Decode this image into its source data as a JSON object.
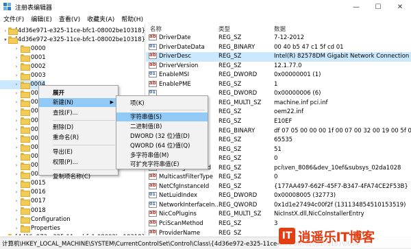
{
  "window": {
    "title": "注册表编辑器",
    "minimize": "—",
    "maximize": "☐",
    "close": "✕"
  },
  "menu": [
    "文件(F)",
    "编辑(E)",
    "查看(V)",
    "收藏夹(A)",
    "帮助(H)"
  ],
  "tree": {
    "items": [
      {
        "label": "{4d36e971-e325-11ce-bfc1-08002be10318}",
        "indent": 0,
        "expanded": false
      },
      {
        "label": "{4d36e972-e325-11ce-bfc1-08002be10318}",
        "indent": 0,
        "expanded": true
      },
      {
        "label": "0000",
        "indent": 1
      },
      {
        "label": "0001",
        "indent": 1
      },
      {
        "label": "0002",
        "indent": 1
      },
      {
        "label": "0003",
        "indent": 1
      },
      {
        "label": "0004",
        "indent": 1,
        "selected": true
      },
      {
        "label": "0005",
        "indent": 1
      },
      {
        "label": "0006",
        "indent": 1
      },
      {
        "label": "0007",
        "indent": 1
      },
      {
        "label": "0008",
        "indent": 1
      },
      {
        "label": "0009",
        "indent": 1
      },
      {
        "label": "0010",
        "indent": 1
      },
      {
        "label": "0011",
        "indent": 1
      },
      {
        "label": "0012",
        "indent": 1
      },
      {
        "label": "0013",
        "indent": 1
      },
      {
        "label": "0014",
        "indent": 1
      },
      {
        "label": "0015",
        "indent": 1
      },
      {
        "label": "0016",
        "indent": 1
      },
      {
        "label": "0017",
        "indent": 1
      },
      {
        "label": "0018",
        "indent": 1
      },
      {
        "label": "Configuration",
        "indent": 1
      },
      {
        "label": "Properties",
        "indent": 1
      },
      {
        "label": "{4d36e973-e325-11ce-bfc1-08002be10318}",
        "indent": 0,
        "expanded": false
      }
    ]
  },
  "list": {
    "headers": {
      "name": "名称",
      "type": "类型",
      "data": "数据"
    },
    "rows": [
      {
        "name": "DriverDate",
        "type": "REG_SZ",
        "data": "7-12-2012",
        "icon": "str"
      },
      {
        "name": "DriverDateData",
        "type": "REG_BINARY",
        "data": "00 40 b5 47 c1 5f cd 01",
        "icon": "bin"
      },
      {
        "name": "DriverDesc",
        "type": "REG_SZ",
        "data": "Intel(R) 82578DM Gigabit Network Connection",
        "icon": "str",
        "selected": true
      },
      {
        "name": "DriverVersion",
        "type": "REG_SZ",
        "data": "12.1.77.0",
        "icon": "str"
      },
      {
        "name": "EnableMSI",
        "type": "REG_DWORD",
        "data": "0x00000001 (1)",
        "icon": "bin"
      },
      {
        "name": "EnablePME",
        "type": "REG_SZ",
        "data": "1",
        "icon": "str"
      },
      {
        "name": "",
        "type": "REG_DWORD",
        "data": "0x00000006 (6)",
        "icon": "bin"
      },
      {
        "name": "",
        "type": "REG_MULTI_SZ",
        "data": "machine.inf pci.inf",
        "icon": "str"
      },
      {
        "name": "",
        "type": "REG_SZ",
        "data": "oem22.inf",
        "icon": "str"
      },
      {
        "name": "",
        "type": "REG_SZ",
        "data": "E10EF",
        "icon": "str"
      },
      {
        "name": "",
        "type": "REG_BINARY",
        "data": "df 07 05 00 00 00 1f 00 07 00 32 00 19 00 5f 00",
        "icon": "bin"
      },
      {
        "name": "",
        "type": "REG_SZ",
        "data": "65535",
        "icon": "str"
      },
      {
        "name": "",
        "type": "REG_SZ",
        "data": "51",
        "icon": "str"
      },
      {
        "name": "",
        "type": "REG_SZ",
        "data": "0",
        "icon": "str"
      },
      {
        "name": "MatchingDeviceId",
        "type": "REG_SZ",
        "data": "pci\\ven_8086&dev_10ef&subsys_02da1028",
        "icon": "str"
      },
      {
        "name": "MulticastFilterType",
        "type": "REG_SZ",
        "data": "0",
        "icon": "str"
      },
      {
        "name": "NetCfgInstanceId",
        "type": "REG_SZ",
        "data": "{177AA497-662F-45F7-B347-4FA74CE2F53B}",
        "icon": "str"
      },
      {
        "name": "NetLuidIndex",
        "type": "REG_DWORD",
        "data": "0x00008005 (32773)",
        "icon": "bin"
      },
      {
        "name": "NetworkInterfaceIn...",
        "type": "REG_QWORD",
        "data": "0x1d1e27494c00f2f (131134854510153519)",
        "icon": "bin"
      },
      {
        "name": "NicCoPlugins",
        "type": "REG_MULTI_SZ",
        "data": "NicInstX.dll,NicColnstallerEntry",
        "icon": "str"
      },
      {
        "name": "PciScanMethod",
        "type": "REG_SZ",
        "data": "3",
        "icon": "str"
      },
      {
        "name": "ProviderName",
        "type": "REG_SZ",
        "data": "",
        "icon": "str"
      }
    ]
  },
  "context_menu": {
    "items": [
      {
        "label": "展开",
        "bold": true
      },
      {
        "label": "新建(N)",
        "submenu": true,
        "highlighted": true
      },
      {
        "label": "查找(F)..."
      },
      {
        "sep": true
      },
      {
        "label": "删除(D)"
      },
      {
        "label": "重命名(R)"
      },
      {
        "sep": true
      },
      {
        "label": "导出(E)"
      },
      {
        "label": "权限(P)..."
      },
      {
        "sep": true
      },
      {
        "label": "复制项名称(C)"
      }
    ]
  },
  "submenu": {
    "items": [
      {
        "label": "项(K)"
      },
      {
        "sep": true
      },
      {
        "label": "字符串值(S)",
        "highlighted": true
      },
      {
        "label": "二进制值(B)"
      },
      {
        "label": "DWORD (32 位)值(D)"
      },
      {
        "label": "QWORD (64 位)值(Q)"
      },
      {
        "label": "多字符串值(M)"
      },
      {
        "label": "可扩充字符串值(E)"
      }
    ]
  },
  "statusbar": {
    "path": "计算机\\HKEY_LOCAL_MACHINE\\SYSTEM\\CurrentControlSet\\Control\\Class\\{4d36e972-e325-11ce-bfc1-08002be10318}\\0004"
  },
  "watermark": {
    "badge": "IT",
    "text": "逍遥乐IT博客"
  },
  "colors": {
    "selection": "#cce8ff",
    "menu_highlight": "#91c9f7",
    "watermark": "#e53d12"
  }
}
